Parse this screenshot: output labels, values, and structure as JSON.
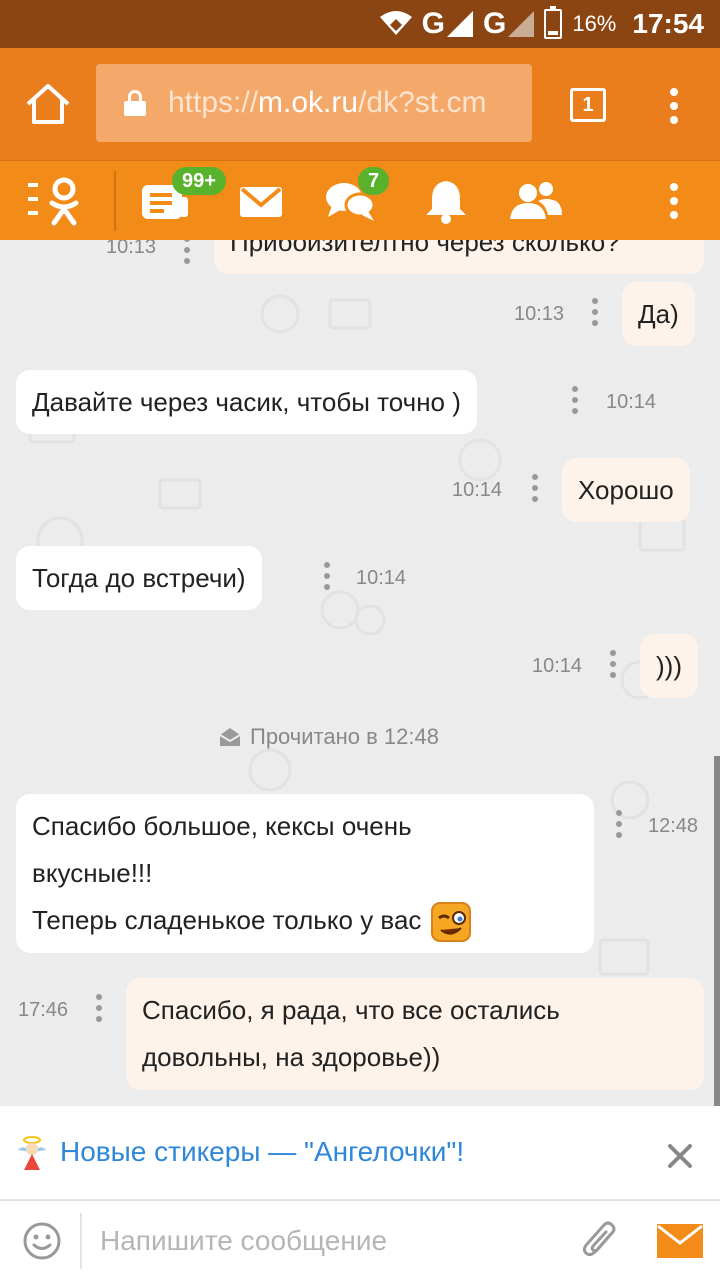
{
  "status_bar": {
    "network_1": "G",
    "network_2": "G",
    "battery_percent": "16%",
    "time": "17:54"
  },
  "browser": {
    "url_prefix": "https://",
    "url_host": "m.ok.ru",
    "url_path": "/dk?st.cm",
    "tab_count": "1"
  },
  "app_toolbar": {
    "feed_badge": "99+",
    "discussions_badge": "7",
    "icons": [
      "ok-logo-icon",
      "feed-icon",
      "mail-icon",
      "discussions-icon",
      "bell-icon",
      "friends-icon",
      "more-icon"
    ]
  },
  "messages": [
    {
      "side": "out",
      "text": "Прибоизителтно через сколько?",
      "time": "10:13"
    },
    {
      "side": "out",
      "text": "Да)",
      "time": "10:13"
    },
    {
      "side": "in",
      "text": "Давайте через часик, чтобы точно )",
      "time": "10:14"
    },
    {
      "side": "out",
      "text": "Хорошо",
      "time": "10:14"
    },
    {
      "side": "in",
      "text": "Тогда до встречи)",
      "time": "10:14"
    },
    {
      "side": "out",
      "text": ")))",
      "time": "10:14"
    },
    {
      "side": "in",
      "line1": "Спасибо большое, кексы очень",
      "line2": "вкусные!!!",
      "line3": "Теперь сладенькое только у вас",
      "time": "12:48"
    },
    {
      "side": "out",
      "line1": "Спасибо, я рада, что все остались",
      "line2": "довольны, на здоровье))",
      "time": "17:46"
    }
  ],
  "read_status": "Прочитано в 12:48",
  "promo": {
    "text": "Новые стикеры — \"Ангелочки\"!"
  },
  "input": {
    "placeholder": "Напишите сообщение",
    "value": ""
  },
  "colors": {
    "status_bar": "#8a4512",
    "browser_bar": "#ea7d1c",
    "app_toolbar": "#f28b18",
    "badge": "#58b22c",
    "promo_link": "#2f87d8",
    "send_icon": "#f28b18"
  }
}
